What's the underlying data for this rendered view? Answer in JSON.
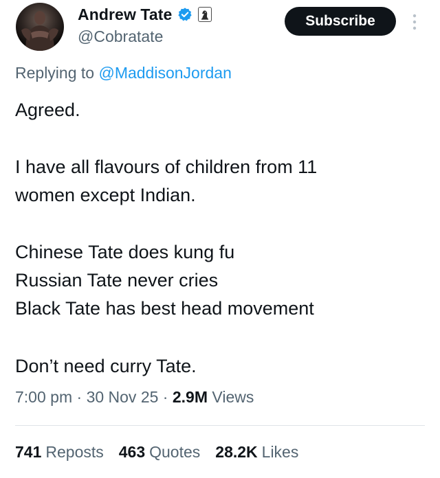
{
  "author": {
    "display_name": "Andrew Tate",
    "handle": "@Cobratate",
    "avatar_icon": "avatar-photo",
    "verified_icon": "verified-badge-icon",
    "affiliate_icon": "chess-knight-badge-icon"
  },
  "actions": {
    "subscribe_label": "Subscribe",
    "more_icon": "more-vertical-icon"
  },
  "reply": {
    "prefix": "Replying to ",
    "handle": "@MaddisonJordan"
  },
  "tweet": {
    "lines": [
      "Agreed.",
      "I have all flavours of children from 11",
      "women except Indian.",
      "Chinese Tate does kung fu",
      "Russian Tate never cries",
      "Black Tate has best head movement",
      "Don’t need curry Tate."
    ]
  },
  "meta": {
    "time": "7:00 pm",
    "separator": " · ",
    "date": "30 Nov 25",
    "views_count": "2.9M",
    "views_label": " Views"
  },
  "stats": [
    {
      "count": "741",
      "label": "Reposts"
    },
    {
      "count": "463",
      "label": "Quotes"
    },
    {
      "count": "28.2K",
      "label": "Likes"
    }
  ],
  "colors": {
    "text": "#0f1419",
    "secondary": "#536471",
    "link": "#1d9bf0",
    "verified": "#1d9bf0",
    "button_bg": "#0f1419",
    "divider": "#dfe3e7"
  }
}
